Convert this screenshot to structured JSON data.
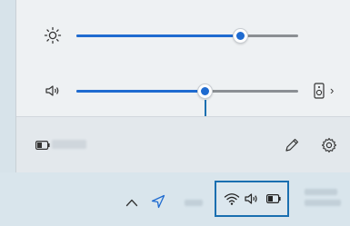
{
  "quick_settings": {
    "brightness": {
      "icon": "sun-icon",
      "level": 0.74
    },
    "volume": {
      "icon": "speaker-icon",
      "level": 0.58,
      "output_icon": "speaker-device-icon",
      "more_glyph": "›"
    },
    "footer": {
      "battery_icon": "battery-icon",
      "edit_icon": "pencil-icon",
      "settings_icon": "gear-icon"
    }
  },
  "taskbar": {
    "overflow_icon": "chevron-up-icon",
    "location_icon": "location-arrow-icon",
    "tray_icons": [
      "wifi-icon",
      "volume-icon",
      "battery-icon"
    ]
  },
  "colors": {
    "accent": "#1f6bd0",
    "callout": "#1a6fb0"
  }
}
